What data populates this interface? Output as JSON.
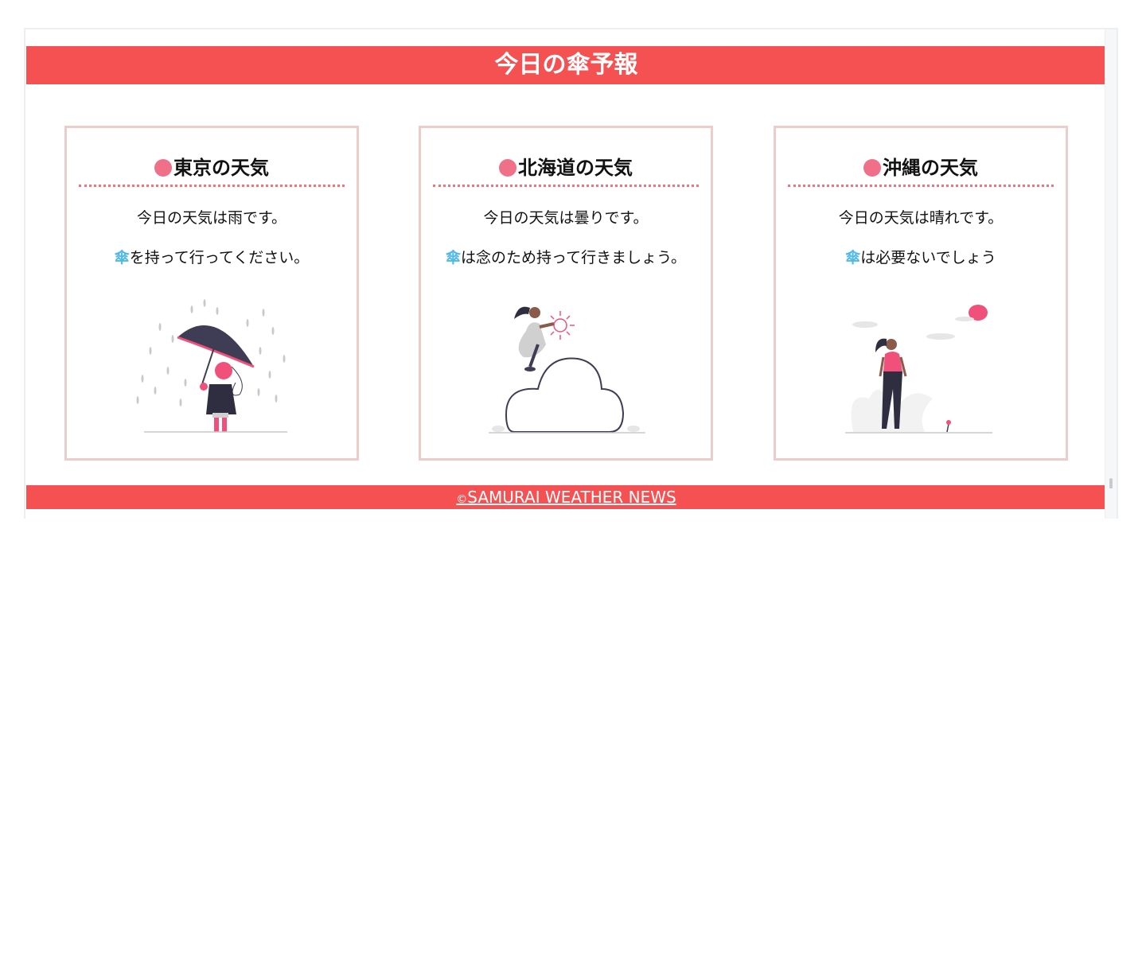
{
  "header": {
    "title": "今日の傘予報"
  },
  "cards": [
    {
      "title": "東京の天気",
      "weather_text": "今日の天気は雨です。",
      "umbrella_glyph": "傘",
      "advice": "を持って行ってください。",
      "illustration": "rain-girl-umbrella"
    },
    {
      "title": "北海道の天気",
      "weather_text": "今日の天気は曇りです。",
      "umbrella_glyph": "傘",
      "advice": "は念のため持って行きましょう。",
      "illustration": "woman-on-cloud"
    },
    {
      "title": "沖縄の天気",
      "weather_text": "今日の天気は晴れです。",
      "umbrella_glyph": "傘",
      "advice": "は必要ないでしょう",
      "illustration": "woman-sunny-day"
    }
  ],
  "footer": {
    "copyright_symbol": "©",
    "link_text": "SAMURAI WEATHER NEWS"
  },
  "colors": {
    "brand_red": "#f55153",
    "card_border": "#edcccc",
    "dot_pink": "#f0708a",
    "umbrella_blue": "#4fb9e8"
  }
}
